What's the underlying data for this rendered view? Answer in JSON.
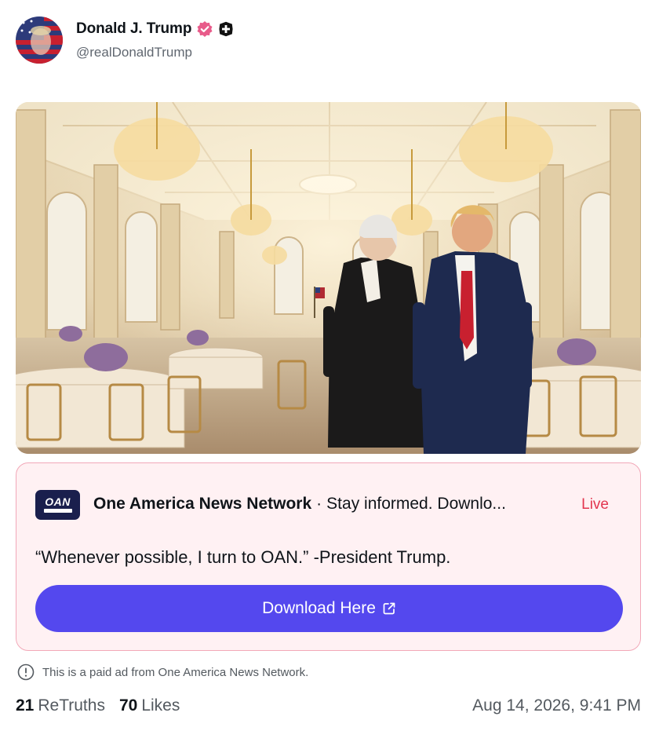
{
  "author": {
    "display_name": "Donald J. Trump",
    "handle": "@realDonaldTrump",
    "avatar_icon": "avatar-flag-portrait",
    "verified_icon": "verified-badge-icon",
    "plus_icon": "plus-badge-icon"
  },
  "post_image": {
    "alt_icon": "ballroom-illustration"
  },
  "ad": {
    "logo_text": "OAN",
    "source": "One America News Network",
    "separator": "·",
    "tagline": "Stay informed. Downlo...",
    "live_label": "Live",
    "quote": "“Whenever possible, I turn to OAN.” -President Trump.",
    "button_label": "Download Here",
    "button_icon": "external-link-icon"
  },
  "ad_note": {
    "text": "This is a paid ad from One America News Network.",
    "icon": "info-icon"
  },
  "stats": {
    "retruths_count": "21",
    "retruths_label": "ReTruths",
    "likes_count": "70",
    "likes_label": "Likes"
  },
  "timestamp": "Aug 14, 2026, 9:41 PM",
  "colors": {
    "accent_button": "#5448ee",
    "ad_background": "#fff1f3",
    "ad_border": "#f2a8b8",
    "live_red": "#e2364f",
    "verified_pink": "#e85b8a"
  }
}
